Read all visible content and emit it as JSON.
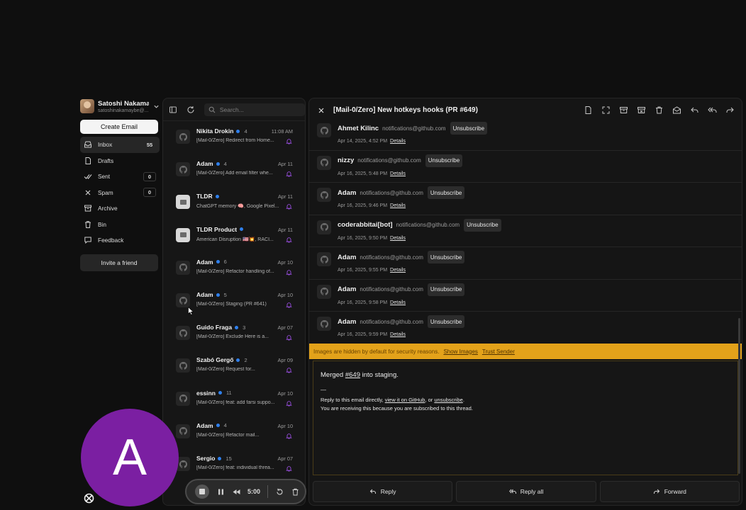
{
  "user": {
    "name": "Satoshi Nakama...",
    "email": "satoshinakamaybe@..."
  },
  "sidebar": {
    "create_label": "Create Email",
    "items": [
      {
        "label": "Inbox",
        "count": "55",
        "icon": "inbox-icon"
      },
      {
        "label": "Drafts",
        "count": "",
        "icon": "drafts-icon"
      },
      {
        "label": "Sent",
        "count": "0",
        "icon": "sent-icon"
      },
      {
        "label": "Spam",
        "count": "0",
        "icon": "spam-icon"
      },
      {
        "label": "Archive",
        "count": "",
        "icon": "archive-icon"
      },
      {
        "label": "Bin",
        "count": "",
        "icon": "bin-icon"
      },
      {
        "label": "Feedback",
        "count": "",
        "icon": "feedback-icon"
      }
    ],
    "invite_label": "Invite a friend"
  },
  "search": {
    "placeholder": "Search..."
  },
  "mail_list": [
    {
      "sender": "Nikita Drokin",
      "count": "4",
      "date": "11:08 AM",
      "subject": "[Mail-0/Zero] Redirect from Home..."
    },
    {
      "sender": "Adam",
      "count": "4",
      "date": "Apr 11",
      "subject": "[Mail-0/Zero] Add email filter whe..."
    },
    {
      "sender": "TLDR",
      "count": "",
      "date": "Apr 11",
      "subject": "ChatGPT memory 🧠, Google Pixel..."
    },
    {
      "sender": "TLDR Product",
      "count": "",
      "date": "Apr 11",
      "subject": "American Disruption 🇺🇸💥, RACI..."
    },
    {
      "sender": "Adam",
      "count": "6",
      "date": "Apr 10",
      "subject": "[Mail-0/Zero] Refactor handling of..."
    },
    {
      "sender": "Adam",
      "count": "5",
      "date": "Apr 10",
      "subject": "[Mail-0/Zero] Staging (PR #641)"
    },
    {
      "sender": "Guido Fraga",
      "count": "3",
      "date": "Apr 07",
      "subject": "[Mail-0/Zero] Exclude Here is a..."
    },
    {
      "sender": "Szabó Gergő",
      "count": "2",
      "date": "Apr 09",
      "subject": "[Mail-0/Zero] Request for..."
    },
    {
      "sender": "essinn",
      "count": "11",
      "date": "Apr 10",
      "subject": "[Mail-0/Zero] feat: add farsi suppo..."
    },
    {
      "sender": "Adam",
      "count": "4",
      "date": "Apr 10",
      "subject": "[Mail-0/Zero] Refactor mail..."
    },
    {
      "sender": "Sergio",
      "count": "15",
      "date": "Apr 07",
      "subject": "[Mail-0/Zero] feat: individual threa..."
    }
  ],
  "reader": {
    "title": "[Mail-0/Zero] New hotkeys hooks (PR #649)",
    "thread": [
      {
        "name": "Ahmet Kilinc",
        "email": "notifications@github.com",
        "date": "Apr 14, 2025, 4:52 PM"
      },
      {
        "name": "nizzy",
        "email": "notifications@github.com",
        "date": "Apr 16, 2025, 5:48 PM"
      },
      {
        "name": "Adam",
        "email": "notifications@github.com",
        "date": "Apr 16, 2025, 9:46 PM"
      },
      {
        "name": "coderabbitai[bot]",
        "email": "notifications@github.com",
        "date": "Apr 16, 2025, 9:50 PM"
      },
      {
        "name": "Adam",
        "email": "notifications@github.com",
        "date": "Apr 16, 2025, 9:55 PM"
      },
      {
        "name": "Adam",
        "email": "notifications@github.com",
        "date": "Apr 16, 2025, 9:58 PM"
      },
      {
        "name": "Adam",
        "email": "notifications@github.com",
        "date": "Apr 16, 2025, 9:59 PM"
      }
    ],
    "unsubscribe_label": "Unsubscribe",
    "details_label": "Details",
    "warning": {
      "text": "Images are hidden by default for security reasons.",
      "show_images": "Show Images",
      "trust_sender": "Trust Sender"
    },
    "body": {
      "merged_prefix": "Merged ",
      "pr_link": "#649",
      "merged_suffix": " into staging.",
      "dash": "—",
      "reply_prefix": "Reply to this email directly, ",
      "view_link": "view it on GitHub",
      "reply_middle": ", or ",
      "unsub_link": "unsubscribe",
      "reply_suffix": ".",
      "receiving": "You are receiving this because you are subscribed to this thread."
    },
    "actions": {
      "reply": "Reply",
      "reply_all": "Reply all",
      "forward": "Forward"
    }
  },
  "overlay": {
    "avatar_letter": "A",
    "avatar_color": "#7b1fa2",
    "timer": "5:00"
  },
  "colors": {
    "unread_dot": "#2f80ed",
    "bell": "#a855f7",
    "warning_bar": "#e3a21a"
  }
}
